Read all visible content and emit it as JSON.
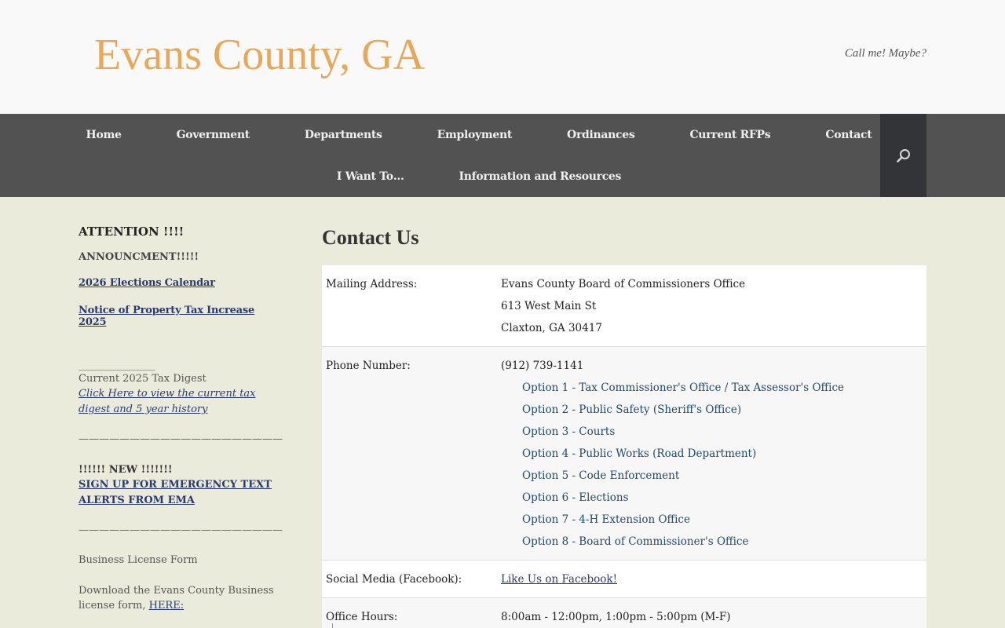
{
  "header": {
    "site_title": "Evans County, GA",
    "tagline": "Call me! Maybe?"
  },
  "nav": {
    "row1": [
      "Home",
      "Government",
      "Departments",
      "Employment",
      "Ordinances",
      "Current RFPs",
      "Contact"
    ],
    "row2": [
      "I Want To…",
      "Information and Resources"
    ],
    "search_icon": "search-icon"
  },
  "sidebar": {
    "heading": "ATTENTION !!!!",
    "announcement": "ANNOUNCMENT!!!!!",
    "link_elections": "2026 Elections Calendar",
    "link_tax_increase": "Notice of Property Tax Increase 2025",
    "divider_short": "_______________",
    "tax_digest_label": "Current 2025 Tax Digest",
    "tax_digest_link": "Click Here to view the current tax digest and 5 year history",
    "divider_long1": "—————————————————————",
    "new_label": "!!!!!! NEW !!!!!!!",
    "ema_link": "SIGN UP FOR EMERGENCY TEXT ALERTS FROM EMA",
    "divider_long2": "—————————————————————-",
    "business_form_title": "Business License Form",
    "business_form_text": "Download the Evans County Business license form, ",
    "business_form_link": "HERE:"
  },
  "content": {
    "page_title": "Contact Us",
    "mailing_label": "Mailing Address:",
    "mailing_lines": [
      "Evans County Board of Commissioners Office",
      "613 West Main St",
      "Claxton, GA 30417"
    ],
    "phone_label": "Phone Number:",
    "phone_number": "(912) 739-1141",
    "phone_options": [
      "Option 1 - Tax Commissioner's Office / Tax Assessor's Office",
      "Option 2 - Public Safety (Sheriff's Office)",
      "Option 3 - Courts",
      "Option 4 - Public Works (Road Department)",
      "Option 5 - Code Enforcement",
      "Option 6 - Elections",
      "Option 7 - 4-H Extension Office",
      "Option 8 - Board of Commissioner's Office"
    ],
    "social_label": "Social Media (Facebook):",
    "social_link": "Like Us on Facebook!",
    "hours_label": "Office Hours:",
    "hours_value": "8:00am - 12:00pm, 1:00pm - 5:00pm (M-F)"
  },
  "colors": {
    "title": "#e8a85a",
    "nav_bg": "#525252",
    "search_bg": "#333438",
    "page_bg": "#ebebdc",
    "link": "#2b3a6e",
    "option": "#1f4a68"
  }
}
